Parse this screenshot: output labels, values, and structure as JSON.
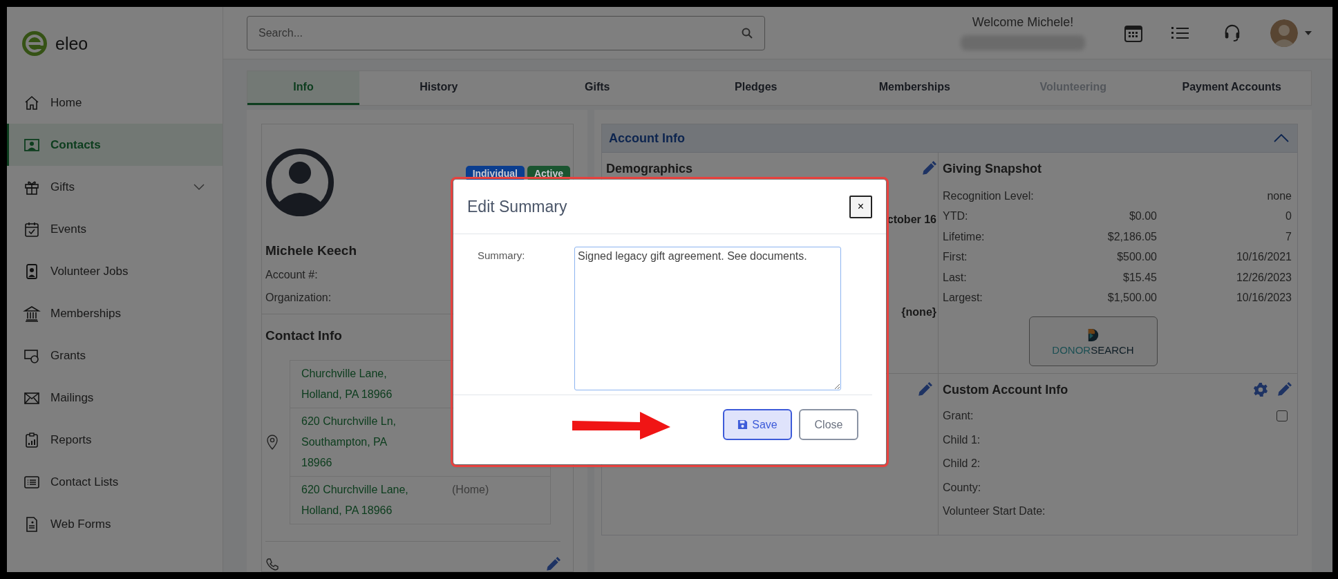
{
  "sidebar": {
    "logo": "eleo",
    "items": [
      {
        "label": "Home",
        "selected": false,
        "kind": "link"
      },
      {
        "label": "Contacts",
        "selected": true,
        "kind": "link"
      },
      {
        "label": "Gifts",
        "selected": false,
        "kind": "group",
        "expanded": false
      },
      {
        "label": "Events",
        "selected": false,
        "kind": "link"
      },
      {
        "label": "Volunteer Jobs",
        "selected": false,
        "kind": "link"
      },
      {
        "label": "Memberships",
        "selected": false,
        "kind": "link"
      },
      {
        "label": "Grants",
        "selected": false,
        "kind": "link"
      },
      {
        "label": "Mailings",
        "selected": false,
        "kind": "link"
      },
      {
        "label": "Reports",
        "selected": false,
        "kind": "link"
      },
      {
        "label": "Contact Lists",
        "selected": false,
        "kind": "link"
      },
      {
        "label": "Web Forms",
        "selected": false,
        "kind": "link"
      }
    ]
  },
  "topbar": {
    "search": {
      "placeholder": "Search..."
    },
    "welcome": "Welcome Michele!"
  },
  "tabs": [
    {
      "label": "Info",
      "selected": true,
      "disabled": false
    },
    {
      "label": "History",
      "selected": false,
      "disabled": false
    },
    {
      "label": "Gifts",
      "selected": false,
      "disabled": false
    },
    {
      "label": "Pledges",
      "selected": false,
      "disabled": false
    },
    {
      "label": "Memberships",
      "selected": false,
      "disabled": false
    },
    {
      "label": "Volunteering",
      "selected": false,
      "disabled": true
    },
    {
      "label": "Payment Accounts",
      "selected": false,
      "disabled": false
    }
  ],
  "contact": {
    "badges": [
      {
        "label": "Individual",
        "color": "#0a3d8f"
      },
      {
        "label": "Active",
        "color": "#1a5530"
      }
    ],
    "name": "Michele Keech",
    "fields": [
      "Account #:",
      "Organization:"
    ],
    "contact_info_title": "Contact Info",
    "addresses": [
      {
        "text": "Churchville Lane,\nHolland, PA 18966"
      },
      {
        "text": "620 Churchville Ln,\nSouthampton, PA\n18966"
      },
      {
        "text": "620 Churchville Lane,\nHolland, PA 18966",
        "tag": "(Home)"
      }
    ]
  },
  "account_info": {
    "title": "Account Info",
    "expanded": true,
    "demographics": {
      "title": "Demographics",
      "values": [
        "ctober 16",
        "{none}"
      ]
    },
    "giving": {
      "title": "Giving Snapshot",
      "rows": [
        {
          "label": "Recognition Level:",
          "value": "none"
        },
        {
          "label": "YTD:",
          "amount": "$0.00",
          "value": "0"
        },
        {
          "label": "Lifetime:",
          "amount": "$2,186.05",
          "value": "7"
        },
        {
          "label": "First:",
          "amount": "$500.00",
          "value": "10/16/2021"
        },
        {
          "label": "Last:",
          "amount": "$15.45",
          "value": "12/26/2023"
        },
        {
          "label": "Largest:",
          "amount": "$1,500.00",
          "value": "10/16/2023"
        }
      ],
      "logo_parts": [
        "DONOR",
        "SEARCH"
      ]
    },
    "custom": {
      "title": "Custom Account Info",
      "fields": [
        {
          "label": "Grant:",
          "kind": "checkbox",
          "checked": false
        },
        {
          "label": "Child 1:",
          "kind": "text"
        },
        {
          "label": "Child 2:",
          "kind": "text"
        },
        {
          "label": "County:",
          "kind": "text"
        },
        {
          "label": "Volunteer Start Date:",
          "kind": "text"
        }
      ]
    }
  },
  "modal": {
    "title": "Edit Summary",
    "close_icon": "×",
    "label": "Summary:",
    "value": "Signed legacy gift agreement. See documents.",
    "buttons": [
      {
        "label": "Save",
        "kind": "primary"
      },
      {
        "label": "Close",
        "kind": "secondary"
      }
    ]
  }
}
